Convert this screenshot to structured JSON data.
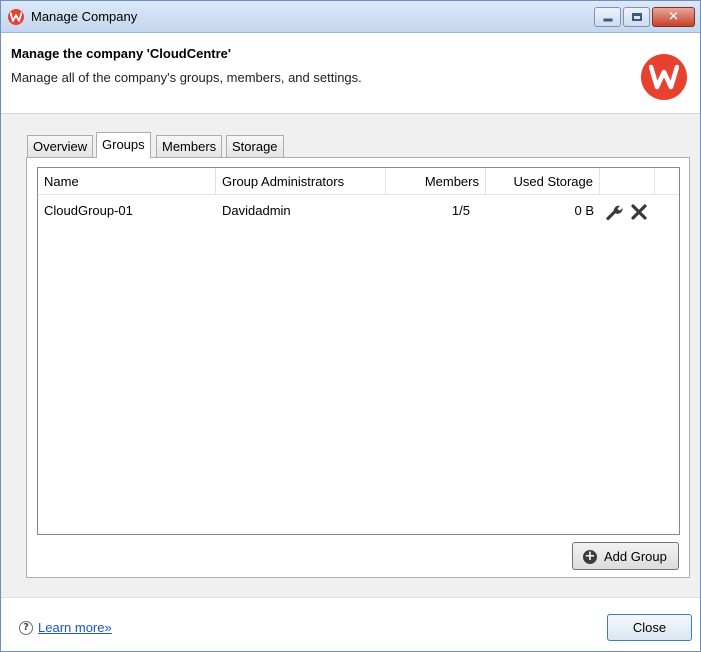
{
  "window": {
    "title": "Manage Company",
    "controls": {
      "minimize": "minimize",
      "maximize": "maximize",
      "close": "✕"
    }
  },
  "header": {
    "title": "Manage the company 'CloudCentre'",
    "description": "Manage all of the company's groups, members, and settings.",
    "brand_color": "#e8412f"
  },
  "tabs": [
    {
      "label": "Overview",
      "active": false
    },
    {
      "label": "Groups",
      "active": true
    },
    {
      "label": "Members",
      "active": false
    },
    {
      "label": "Storage",
      "active": false
    }
  ],
  "table": {
    "columns": [
      "Name",
      "Group Administrators",
      "Members",
      "Used Storage"
    ],
    "rows": [
      {
        "name": "CloudGroup-01",
        "administrators": "Davidadmin",
        "members": "1/5",
        "used_storage": "0 B",
        "actions": [
          "wrench-icon",
          "delete-x-icon"
        ]
      }
    ]
  },
  "add_group_label": "Add Group",
  "footer": {
    "help_glyph": "?",
    "learn_more": "Learn more»",
    "close_label": "Close",
    "link_color": "#1a56c4"
  }
}
